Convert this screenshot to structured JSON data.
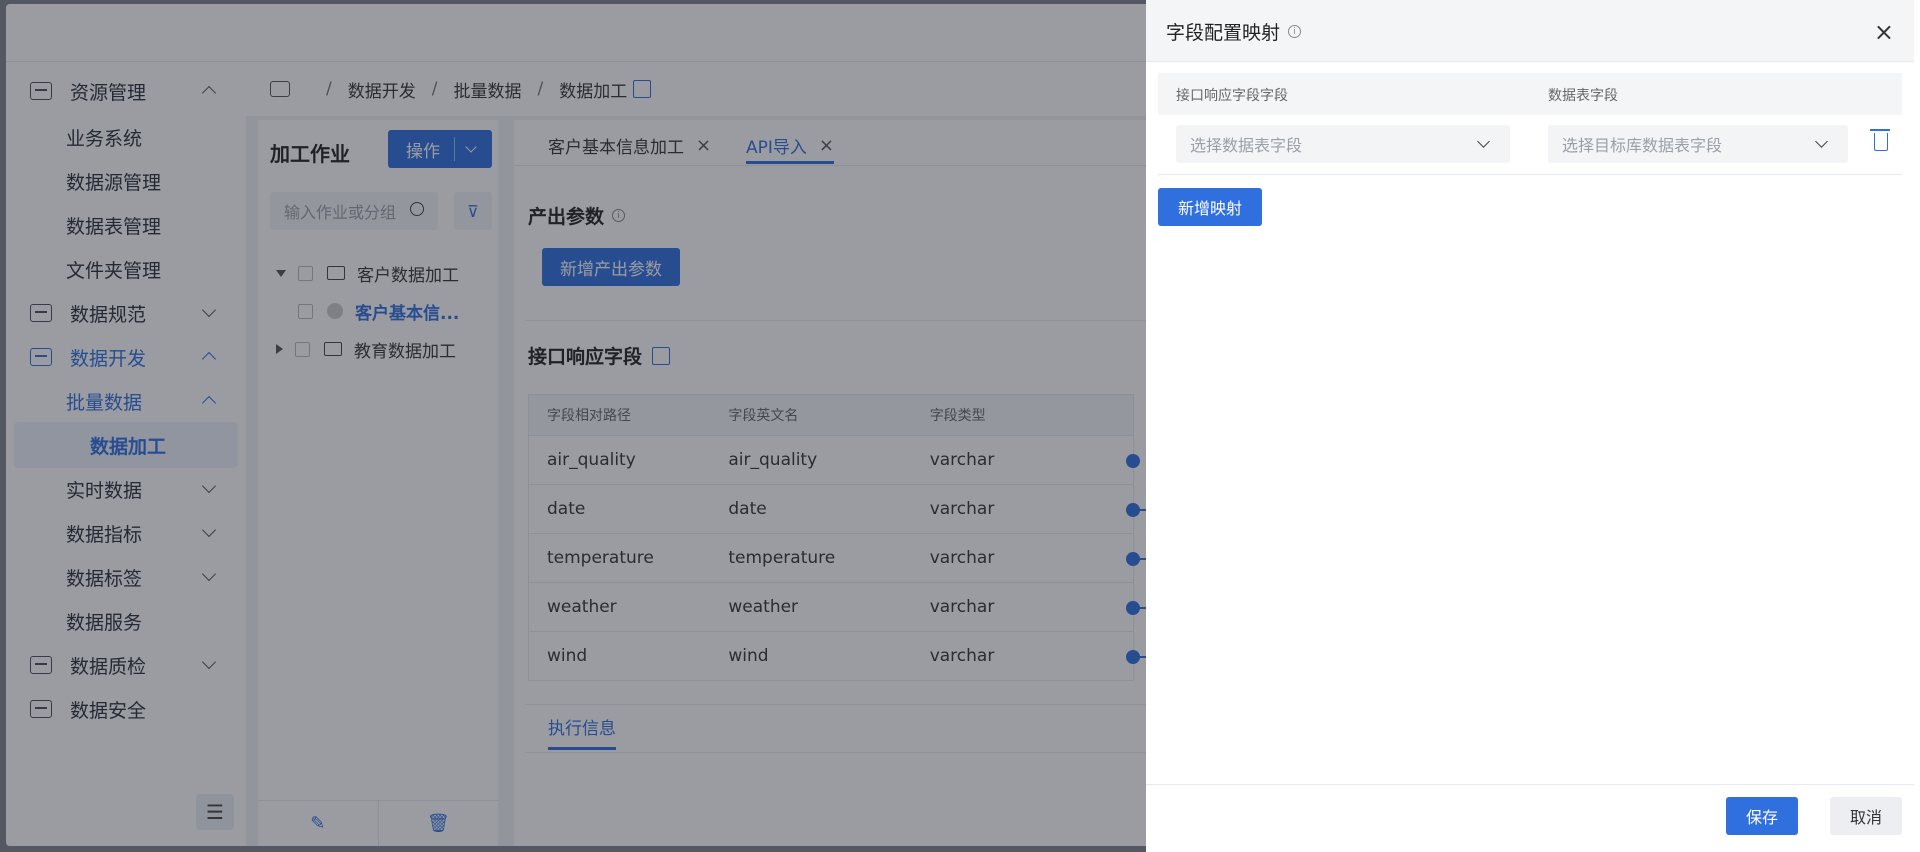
{
  "sidebar": {
    "items": [
      {
        "label": "资源管理",
        "level": 0,
        "chev": "up",
        "icon": "monitor-icon"
      },
      {
        "label": "业务系统",
        "level": 1
      },
      {
        "label": "数据源管理",
        "level": 1
      },
      {
        "label": "数据表管理",
        "level": 1
      },
      {
        "label": "文件夹管理",
        "level": 1
      },
      {
        "label": "数据规范",
        "level": 0,
        "chev": "down",
        "icon": "document-icon"
      },
      {
        "label": "数据开发",
        "level": 0,
        "chev": "up",
        "icon": "code-icon",
        "blue": true
      },
      {
        "label": "批量数据",
        "level": 1,
        "chev": "up",
        "blue": true
      },
      {
        "label": "数据加工",
        "level": 2,
        "active": true
      },
      {
        "label": "实时数据",
        "level": 1,
        "chev": "down"
      },
      {
        "label": "数据指标",
        "level": 1,
        "chev": "down"
      },
      {
        "label": "数据标签",
        "level": 1,
        "chev": "down"
      },
      {
        "label": "数据服务",
        "level": 1
      },
      {
        "label": "数据质检",
        "level": 0,
        "chev": "down",
        "icon": "inspect-icon"
      },
      {
        "label": "数据安全",
        "level": 0,
        "icon": "shield-check-icon"
      }
    ],
    "collapse_glyph": "☰"
  },
  "breadcrumb": {
    "items": [
      "数据开发",
      "批量数据",
      "数据加工"
    ],
    "sep": "/"
  },
  "jobs": {
    "title": "加工作业",
    "op_label": "操作",
    "search_placeholder": "输入作业或分组",
    "filter_glyph": "⊽",
    "tree": [
      {
        "label": "客户数据加工",
        "type": "folder",
        "expanded": true
      },
      {
        "label": "客户基本信...",
        "type": "leaf"
      },
      {
        "label": "教育数据加工",
        "type": "folder",
        "expanded": false
      }
    ],
    "foot": {
      "edit_glyph": "✎",
      "delete_glyph": "🗑"
    }
  },
  "main": {
    "tabs": [
      {
        "label": "客户基本信息加工",
        "close": "×"
      },
      {
        "label": "API导入",
        "close": "×",
        "active": true
      }
    ],
    "output_title": "产出参数",
    "info_glyph": "i",
    "add_param_label": "新增产出参数",
    "resp_title": "接口响应字段",
    "resp_table": {
      "headers": [
        "字段相对路径",
        "字段英文名",
        "字段类型"
      ],
      "rows": [
        [
          "air_quality",
          "air_quality",
          "varchar"
        ],
        [
          "date",
          "date",
          "varchar"
        ],
        [
          "temperature",
          "temperature",
          "varchar"
        ],
        [
          "weather",
          "weather",
          "varchar"
        ],
        [
          "wind",
          "wind",
          "varchar"
        ]
      ]
    },
    "exec_tab": "执行信息"
  },
  "drawer": {
    "title": "字段配置映射",
    "info_glyph": "i",
    "close_glyph": "×",
    "col_left": "接口响应字段字段",
    "col_right": "数据表字段",
    "select_left_placeholder": "选择数据表字段",
    "select_right_placeholder": "选择目标库数据表字段",
    "add_map_label": "新增映射",
    "save_label": "保存",
    "cancel_label": "取消"
  },
  "colors": {
    "accent": "#2f6fde",
    "overlay": "rgba(30,36,48,0.45)"
  }
}
